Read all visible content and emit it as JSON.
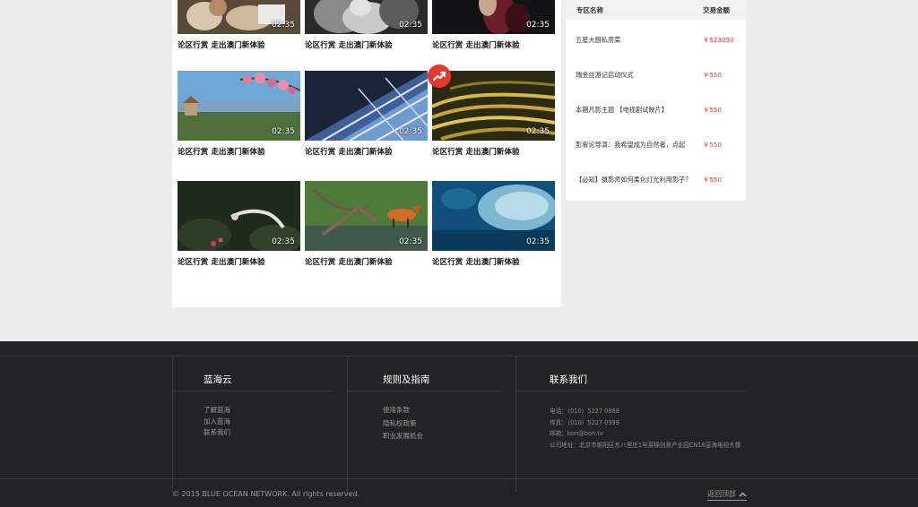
{
  "videos": [
    {
      "title": "论区行赏 走出澳门新体验",
      "duration": "02:35",
      "scene": "people-outdoor"
    },
    {
      "title": "论区行赏 走出澳门新体验",
      "duration": "02:35",
      "scene": "bw-portrait"
    },
    {
      "title": "论区行赏 走出澳门新体验",
      "duration": "02:35",
      "scene": "red-dress"
    },
    {
      "title": "论区行赏 走出澳门新体验",
      "duration": "02:35",
      "scene": "blossom-temple"
    },
    {
      "title": "论区行赏 走出澳门新体验",
      "duration": "02:35",
      "scene": "glass-building"
    },
    {
      "title": "论区行赏 走出澳门新体验",
      "duration": "02:35",
      "scene": "rice-terraces"
    },
    {
      "title": "论区行赏 走出澳门新体验",
      "duration": "02:35",
      "scene": "dancer-garden"
    },
    {
      "title": "论区行赏 走出澳门新体验",
      "duration": "02:35",
      "scene": "fox-water"
    },
    {
      "title": "论区行赏 走出澳门新体验",
      "duration": "02:35",
      "scene": "fish-school"
    }
  ],
  "trend_icon": "trending-up-icon",
  "ranking": {
    "col_name": "专区名称",
    "col_amount": "交易金额",
    "rows": [
      {
        "name": "五星大厨私房菜",
        "amount": "￥523050"
      },
      {
        "name": "瑞金丝游记启动仪式",
        "amount": "￥550"
      },
      {
        "name": "本期凡影主题 【电视剧试映片】",
        "amount": "￥550"
      },
      {
        "name": "影宥论导演：我希望成为自然者，点起",
        "amount": "￥550"
      },
      {
        "name": "【必知】摄影师如何柔化灯光利用影子？",
        "amount": "￥550"
      }
    ]
  },
  "footer": {
    "col1": {
      "heading": "蓝海云",
      "links": [
        "了解蓝海",
        "加入蓝海",
        "联系我们"
      ]
    },
    "col2": {
      "heading": "规则及指南",
      "links": [
        "使用条款",
        "隐私权政策",
        "职业发展机会"
      ]
    },
    "col3": {
      "heading": "联系我们",
      "info": [
        "电话：（010）5227 0888",
        "传真：（010）5227 0999",
        "邮箱：bon@bon.tv",
        "公司地址：北京市朝阳区东八里庄1号莱锦创意产业园CN16蓝海电视大楼"
      ]
    },
    "copyright": "© 2015 BLUE OCEAN NETWORK. All rights reserved.",
    "back_to_top": "返回顶部"
  },
  "colors": {
    "accent_red": "#e8382d",
    "footer_bg": "#232325",
    "page_bg": "#ececec"
  }
}
